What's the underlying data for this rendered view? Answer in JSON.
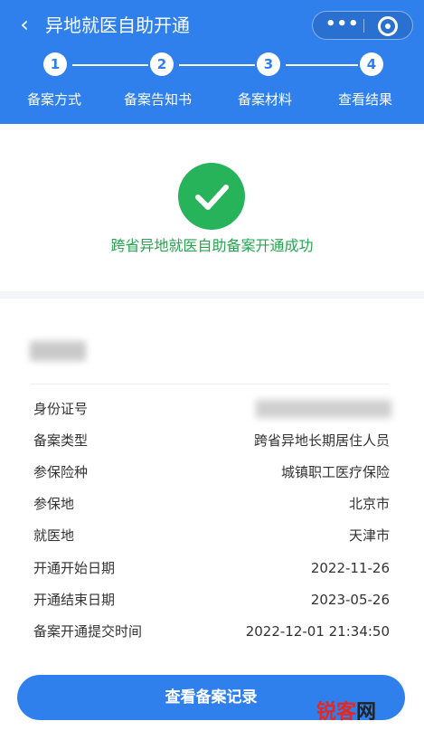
{
  "nav": {
    "back_icon": "chevron-left-icon",
    "title": "异地就医自助开通",
    "more_icon": "ellipsis-icon",
    "close_icon": "target-icon"
  },
  "steps": [
    {
      "number": "1",
      "label": "备案方式"
    },
    {
      "number": "2",
      "label": "备案告知书"
    },
    {
      "number": "3",
      "label": "备案材料"
    },
    {
      "number": "4",
      "label": "查看结果"
    }
  ],
  "success": {
    "icon": "check-circle-icon",
    "message": "跨省异地就医自助备案开通成功",
    "color": "#27b35a"
  },
  "details": [
    {
      "label": "身份证号",
      "value": ""
    },
    {
      "label": "备案类型",
      "value": "跨省异地长期居住人员"
    },
    {
      "label": "参保险种",
      "value": "城镇职工医疗保险"
    },
    {
      "label": "参保地",
      "value": "北京市"
    },
    {
      "label": "就医地",
      "value": "天津市"
    },
    {
      "label": "开通开始日期",
      "value": "2022-11-26"
    },
    {
      "label": "开通结束日期",
      "value": "2023-05-26"
    },
    {
      "label": "备案开通提交时间",
      "value": "2022-12-01 21:34:50"
    }
  ],
  "actions": {
    "view_records": "查看备案记录"
  },
  "watermark": {
    "part1": "锐客",
    "part2": "网"
  },
  "colors": {
    "primary": "#2f80ed",
    "success": "#26a44f",
    "background": "#f3f4f7"
  }
}
